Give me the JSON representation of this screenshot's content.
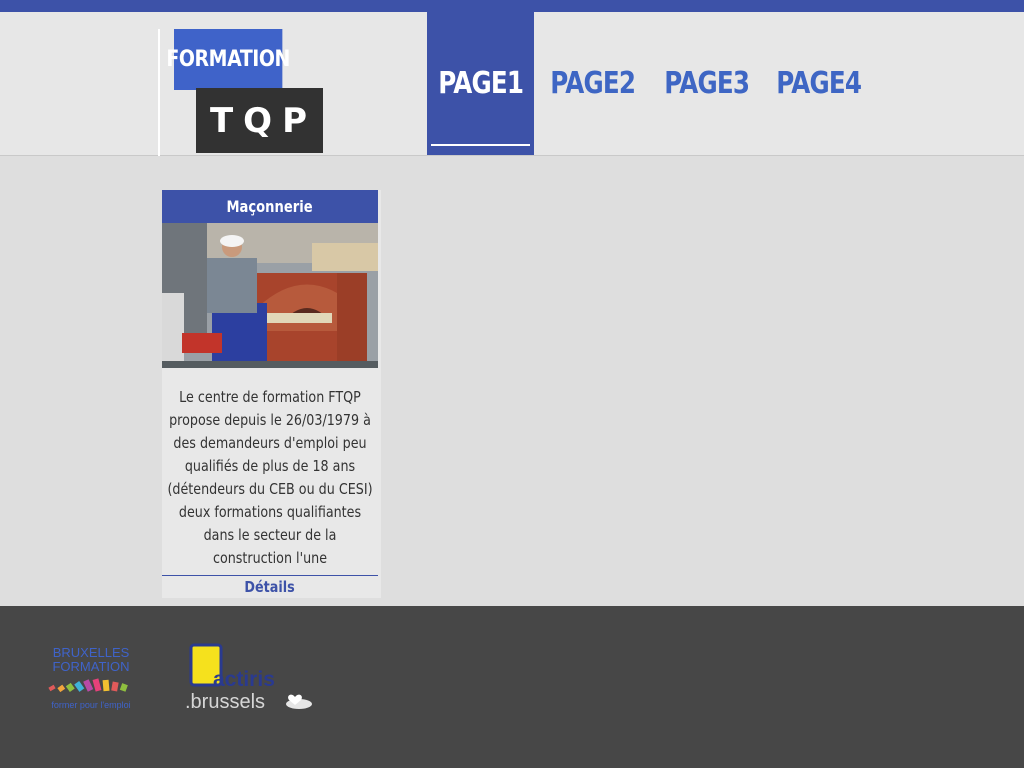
{
  "logo": {
    "top_text": "FORMATION",
    "bottom_text": "TQP"
  },
  "nav": {
    "items": [
      {
        "label": "PAGE1",
        "active": true
      },
      {
        "label": "PAGE2",
        "active": false
      },
      {
        "label": "PAGE3",
        "active": false
      },
      {
        "label": "PAGE4",
        "active": false
      }
    ]
  },
  "card": {
    "title": "Maçonnerie",
    "description": "Le centre de formation FTQP propose depuis le 26/03/1979 à des demandeurs d'emploi peu qualifiés de plus de 18 ans (détendeurs du CEB ou du CESI) deux formations qualifiantes dans le secteur de la construction  l'une",
    "link_label": "Détails"
  },
  "footer": {
    "partners": [
      {
        "line1": "BRUXELLES",
        "line2": "FORMATION",
        "tagline": "former pour l'emploi"
      },
      {
        "name": "actiris",
        "domain": ".brussels"
      }
    ]
  },
  "colors": {
    "brand_blue": "#3d52a8",
    "nav_text": "#3e66c4",
    "logo_blue": "#3f63c9",
    "logo_dark": "#323232",
    "footer_bg": "#474747",
    "page_bg": "#dedede"
  }
}
